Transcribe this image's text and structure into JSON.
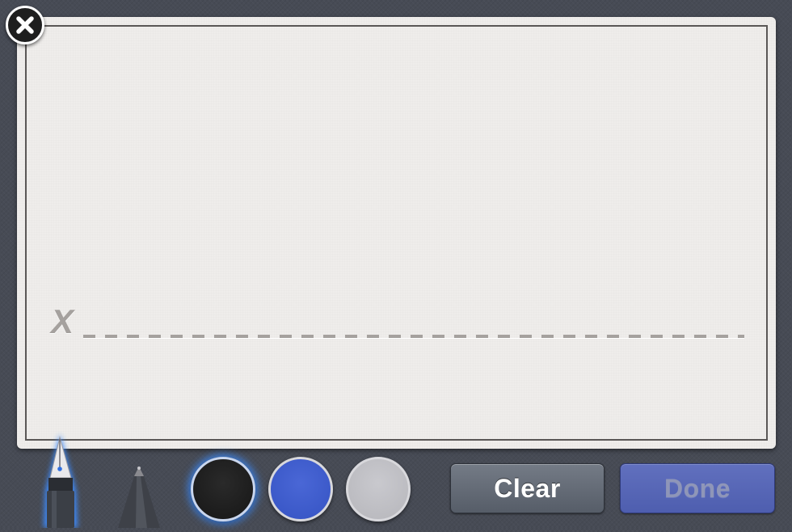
{
  "signature_card": {
    "mark": "X"
  },
  "close_button": {
    "icon": "close-icon"
  },
  "pens": [
    {
      "icon": "fountain-pen-icon",
      "selected": true
    },
    {
      "icon": "ballpoint-pen-icon",
      "selected": false
    }
  ],
  "colors": [
    {
      "name": "black",
      "hex": "#1e1e1e",
      "selected": true
    },
    {
      "name": "blue",
      "hex": "#3d5bcb",
      "selected": false
    },
    {
      "name": "gray",
      "hex": "#c0c0c4",
      "selected": false
    }
  ],
  "toolbar": {
    "clear_label": "Clear",
    "done_label": "Done"
  },
  "theme": {
    "background": "#474b55",
    "card": "#efedeb",
    "selection_glow": "#3c8cff"
  }
}
